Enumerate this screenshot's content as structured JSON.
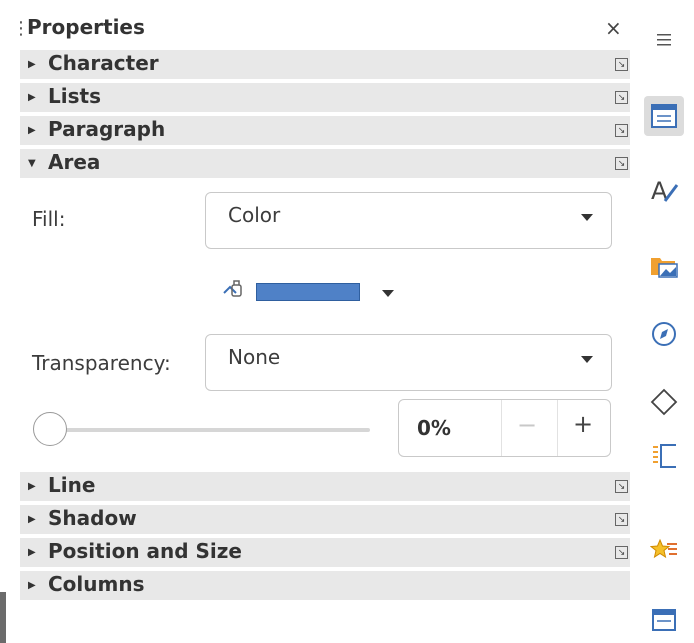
{
  "panel": {
    "title": "Properties",
    "grip": "⋮",
    "close": "×"
  },
  "sections_top": [
    {
      "label": "Character",
      "expanded": false
    },
    {
      "label": "Lists",
      "expanded": false
    },
    {
      "label": "Paragraph",
      "expanded": false
    },
    {
      "label": "Area",
      "expanded": true
    }
  ],
  "area": {
    "fill_label": "Fill:",
    "fill_value": "Color",
    "fill_color": "#4f81c7",
    "transparency_label": "Transparency:",
    "transparency_value": "None",
    "transparency_slider": 0,
    "transparency_percent": "0%",
    "minus": "−",
    "plus": "+"
  },
  "sections_bottom": [
    {
      "label": "Line",
      "expanded": false,
      "has_more": true
    },
    {
      "label": "Shadow",
      "expanded": false,
      "has_more": true
    },
    {
      "label": "Position and Size",
      "expanded": false,
      "has_more": true
    },
    {
      "label": "Columns",
      "expanded": false,
      "has_more": false
    }
  ],
  "icons": {
    "collapsed": "▶",
    "expanded": "▼",
    "more": "↘"
  },
  "tabbar": [
    {
      "name": "menu-icon"
    },
    {
      "name": "properties-icon",
      "active": true
    },
    {
      "name": "styles-icon"
    },
    {
      "name": "gallery-icon"
    },
    {
      "name": "navigator-icon"
    },
    {
      "name": "shapes-icon"
    },
    {
      "name": "page-icon"
    },
    {
      "name": "style-inspector-icon"
    },
    {
      "name": "manage-changes-icon"
    }
  ]
}
